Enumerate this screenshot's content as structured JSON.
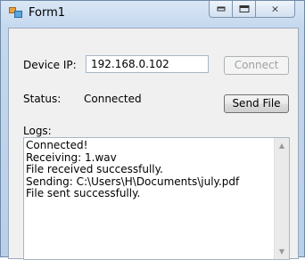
{
  "window": {
    "title": "Form1",
    "icon": "winforms-app-icon",
    "controls": {
      "minimize": "minimize-icon",
      "maximize": "maximize-icon",
      "close": "×"
    }
  },
  "form": {
    "device_ip_label": "Device IP:",
    "device_ip_value": "192.168.0.102",
    "connect_label": "Connect",
    "status_label": "Status:",
    "status_value": "Connected",
    "send_file_label": "Send File",
    "logs_label": "Logs:"
  },
  "logs": [
    "Connected!",
    "Receiving: 1.wav",
    "File received successfully.",
    "Sending: C:\\Users\\H\\Documents\\july.pdf",
    "File sent successfully."
  ],
  "scrollbar": {
    "up": "▲",
    "down": "▼"
  }
}
